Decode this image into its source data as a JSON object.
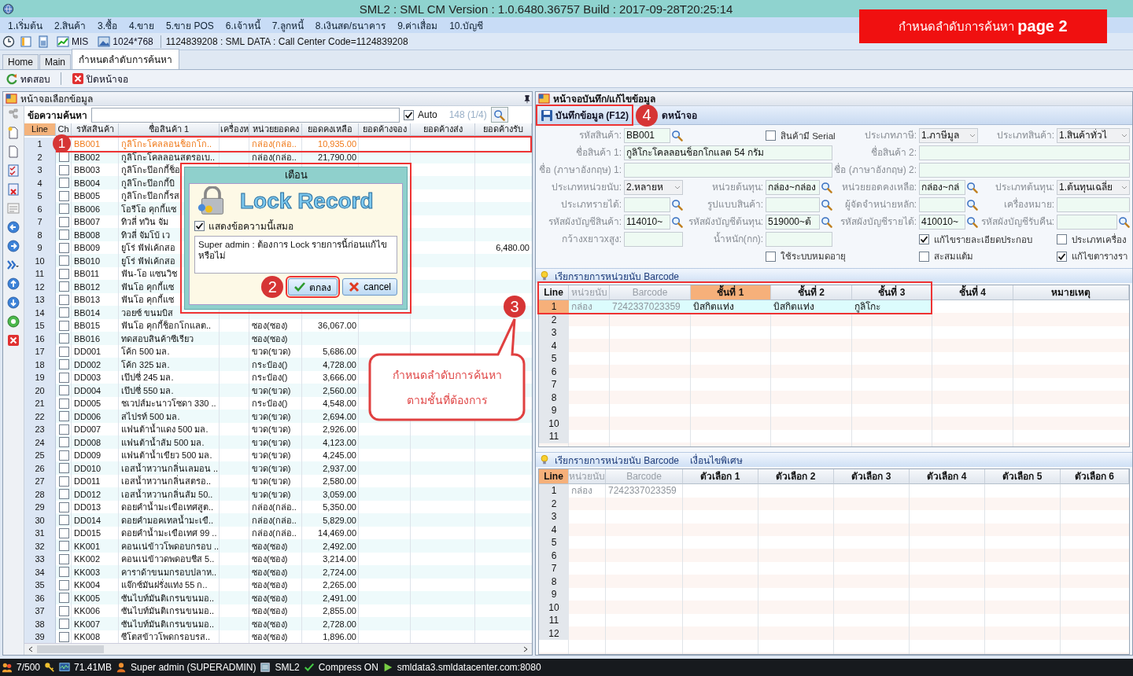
{
  "window": {
    "title": "SML2 : SML CM Version : 1.0.6480.36757  Build : 2017-09-28T20:25:14"
  },
  "banner": "กำหนดลำดับการค้นหา **page 2**",
  "menu": [
    "1.เริ่มต้น",
    "2.สินค้า",
    "3.ซื้อ",
    "4.ขาย",
    "5.ขาย POS",
    "6.เจ้าหนี้",
    "7.ลูกหนี้",
    "8.เงินสด/ธนาคาร",
    "9.ค่าเสื่อม",
    "10.บัญชี"
  ],
  "toolbar": {
    "mis": "MIS",
    "resolution": "1024*768",
    "info": "1124839208 : SML DATA : Call Center Code=1124839208"
  },
  "tabs": [
    {
      "label": "Home",
      "selected": false
    },
    {
      "label": "Main",
      "selected": false
    },
    {
      "label": "กำหนดลำดับการค้นหา",
      "selected": true
    }
  ],
  "actions": [
    "ทดสอบ",
    "ปิดหน้าจอ"
  ],
  "left_panel": {
    "title": "หน้าจอเลือกข้อมูล",
    "search_label": "ข้อความค้นหา",
    "auto": {
      "label": "Auto",
      "checked": true
    },
    "count": "148 (1/4)",
    "columns": [
      "Line",
      "Ch",
      "รหัสสินค้า",
      "ชื่อสินค้า 1",
      "เครื่องห",
      "หน่วยยอดคง",
      "ยอดคงเหลือ",
      "ยอดค้างจอง",
      "ยอดค้างส่ง",
      "ยอดค้างรับ"
    ],
    "rows": [
      {
        "line": "1",
        "code": "BB001",
        "name": "กูลิโกะโคลลอนช็อกโก..",
        "unit": "กล่อง(กล่อ..",
        "balance": "10,935.00",
        "selected": true
      },
      {
        "line": "2",
        "code": "BB002",
        "name": "กูลิโกะโคลลอนสตรอเบ..",
        "unit": "กล่อง(กล่อ..",
        "balance": "21,790.00",
        "checked": false,
        "selected": false
      },
      {
        "line": "3",
        "code": "BB003",
        "name": "กูลิโกะป๊อกกี้ช็อ",
        "checked": false,
        "selected": false
      },
      {
        "line": "4",
        "code": "BB004",
        "name": "กูลิโกะป๊อกกี้บิ",
        "checked": false,
        "selected": false
      },
      {
        "line": "5",
        "code": "BB005",
        "name": "กูลิโกะป๊อกกี้รส",
        "checked": false,
        "selected": false
      },
      {
        "line": "6",
        "code": "BB006",
        "name": "โอรีโอ คุกกี้แซ",
        "checked": false,
        "selected": false
      },
      {
        "line": "7",
        "code": "BB007",
        "name": "ทิวลี่ ทวิน จัม",
        "checked": false,
        "selected": false
      },
      {
        "line": "8",
        "code": "BB008",
        "name": "ทิวลี่ จัมโบ้ เว",
        "checked": false,
        "selected": false
      },
      {
        "line": "9",
        "code": "BB009",
        "name": "ยูโร่ ฟัฟเค้กสอ",
        "incoming": "6,480.00",
        "checked": false,
        "selected": false
      },
      {
        "line": "10",
        "code": "BB010",
        "name": "ยูโร่ ฟัฟเค้กสอ",
        "checked": false,
        "selected": false
      },
      {
        "line": "11",
        "code": "BB011",
        "name": "ฟัน-โอ แซนวิช",
        "checked": false,
        "selected": false
      },
      {
        "line": "12",
        "code": "BB012",
        "name": "ฟันโอ คุกกี้แซ",
        "checked": false,
        "selected": false
      },
      {
        "line": "13",
        "code": "BB013",
        "name": "ฟันโอ คุกกี้แซ",
        "checked": false,
        "selected": false
      },
      {
        "line": "14",
        "code": "BB014",
        "name": "วอยซ์ ขนมบิส",
        "checked": false,
        "selected": false
      },
      {
        "line": "15",
        "code": "BB015",
        "name": "ฟันโอ คุกกี้ช็อกโกแลต..",
        "unit": "ซอง(ซอง)",
        "balance": "36,067.00",
        "checked": false,
        "selected": false
      },
      {
        "line": "16",
        "code": "BB016",
        "name": "ทดสอบสินค้าซีเรียว",
        "unit": "ซอง(ซอง)",
        "checked": false,
        "selected": false
      },
      {
        "line": "17",
        "code": "DD001",
        "name": "โค้ก 500 มล.",
        "unit": "ขวด(ขวด)",
        "balance": "5,686.00",
        "checked": false,
        "selected": false
      },
      {
        "line": "18",
        "code": "DD002",
        "name": "โค้ก 325 มล.",
        "unit": "กระป๋อง()",
        "balance": "4,728.00",
        "checked": false,
        "selected": false
      },
      {
        "line": "19",
        "code": "DD003",
        "name": "เป๊ปซี่ 245 มล.",
        "unit": "กระป๋อง()",
        "balance": "3,666.00",
        "checked": false,
        "selected": false
      },
      {
        "line": "20",
        "code": "DD004",
        "name": "เป๊ปซี่ 550 มล.",
        "unit": "ขวด(ขวด)",
        "balance": "2,560.00",
        "checked": false,
        "selected": false
      },
      {
        "line": "21",
        "code": "DD005",
        "name": "ชเวปส์มะนาวโซดา 330 ..",
        "unit": "กระป๋อง()",
        "balance": "4,548.00",
        "checked": false,
        "selected": false
      },
      {
        "line": "22",
        "code": "DD006",
        "name": "สไปรท์ 500 มล.",
        "unit": "ขวด(ขวด)",
        "balance": "2,694.00",
        "checked": false,
        "selected": false
      },
      {
        "line": "23",
        "code": "DD007",
        "name": "แฟนต้าน้ำแดง 500 มล.",
        "unit": "ขวด(ขวด)",
        "balance": "2,926.00",
        "checked": false,
        "selected": false
      },
      {
        "line": "24",
        "code": "DD008",
        "name": "แฟนต้าน้ำส้ม 500 มล.",
        "unit": "ขวด(ขวด)",
        "balance": "4,123.00",
        "checked": false,
        "selected": false
      },
      {
        "line": "25",
        "code": "DD009",
        "name": "แฟนต้าน้ำเขียว 500 มล.",
        "unit": "ขวด(ขวด)",
        "balance": "4,245.00",
        "checked": false,
        "selected": false
      },
      {
        "line": "26",
        "code": "DD010",
        "name": "เอสน้ำหวานกลิ่นเลมอน ..",
        "unit": "ขวด(ขวด)",
        "balance": "2,937.00",
        "checked": false,
        "selected": false
      },
      {
        "line": "27",
        "code": "DD011",
        "name": "เอสน้ำหวานกลิ่นสตรอ..",
        "unit": "ขวด(ขวด)",
        "balance": "2,580.00",
        "checked": false,
        "selected": false
      },
      {
        "line": "28",
        "code": "DD012",
        "name": "เอสน้ำหวานกลิ่นส้ม 50..",
        "unit": "ขวด(ขวด)",
        "balance": "3,059.00",
        "checked": false,
        "selected": false
      },
      {
        "line": "29",
        "code": "DD013",
        "name": "ดอยคำน้ำมะเขือเทศสูต..",
        "unit": "กล่อง(กล่อ..",
        "balance": "5,350.00",
        "checked": false,
        "selected": false
      },
      {
        "line": "30",
        "code": "DD014",
        "name": "ดอยคำมอคเทลน้ำมะเขื..",
        "unit": "กล่อง(กล่อ..",
        "balance": "5,829.00",
        "checked": false,
        "selected": false
      },
      {
        "line": "31",
        "code": "DD015",
        "name": "ดอยคำน้ำมะเขือเทศ 99 ..",
        "unit": "กล่อง(กล่อ..",
        "balance": "14,469.00",
        "checked": false,
        "selected": false
      },
      {
        "line": "32",
        "code": "KK001",
        "name": "คอนเน่ข้าวโพดอบกรอบ ..",
        "unit": "ซอง(ซอง)",
        "balance": "2,492.00",
        "checked": false,
        "selected": false
      },
      {
        "line": "33",
        "code": "KK002",
        "name": "คอนเน่ข้าวดพดอบชีส 5..",
        "unit": "ซอง(ซอง)",
        "balance": "3,214.00",
        "checked": false,
        "selected": false
      },
      {
        "line": "34",
        "code": "KK003",
        "name": "คาราด้าขนมกรอบปลาห..",
        "unit": "ซอง(ซอง)",
        "balance": "2,724.00",
        "checked": false,
        "selected": false
      },
      {
        "line": "35",
        "code": "KK004",
        "name": "แจ๊กซ์มันฝรั่งแท่ง 55 ก..",
        "unit": "ซอง(ซอง)",
        "balance": "2,265.00",
        "checked": false,
        "selected": false
      },
      {
        "line": "36",
        "code": "KK005",
        "name": "ซันไบท์มันติเกรนขนมอ..",
        "unit": "ซอง(ซอง)",
        "balance": "2,491.00",
        "checked": false,
        "selected": false
      },
      {
        "line": "37",
        "code": "KK006",
        "name": "ซันไบท์มันติเกรนขนมอ..",
        "unit": "ซอง(ซอง)",
        "balance": "2,855.00",
        "checked": false,
        "selected": false
      },
      {
        "line": "38",
        "code": "KK007",
        "name": "ซันไบท์มันติเกรนขนมอ..",
        "unit": "ซอง(ซอง)",
        "balance": "2,728.00",
        "checked": false,
        "selected": false
      },
      {
        "line": "39",
        "code": "KK008",
        "name": "ซีโตสข้าวโพดกรอบรส..",
        "unit": "ซอง(ซอง)",
        "balance": "1,896.00",
        "checked": false,
        "selected": false
      }
    ]
  },
  "dialog": {
    "title": "เตือน",
    "heading": "Lock Record",
    "always_show": {
      "label": "แสดงข้อความนี้เสมอ",
      "checked": true
    },
    "message": "Super admin : ต้องการ Lock รายการนี้ก่อนแก้ไข หรือไม่",
    "buttons": [
      "ตกลง",
      "cancel"
    ]
  },
  "right_panel": {
    "title": "หน้าจอบันทึก/แก้ไขข้อมูล",
    "actions": [
      "บันทึกข้อมูล (F12)",
      "ดหน้าจอ"
    ],
    "form": [
      [
        {
          "kind": "lookup",
          "label": "รหัสสินค้า:",
          "value": "BB001"
        },
        {
          "kind": "checkbox",
          "label": "สินค้ามี Serial",
          "checked": false
        },
        {
          "kind": "select",
          "label": "ประเภทภาษี:",
          "value": "1.ภาษีมูล"
        },
        {
          "kind": "select",
          "label": "ประเภทสินค้า:",
          "value": "1.สินค้าทั่วไ"
        }
      ],
      [
        {
          "kind": "wide",
          "label": "ชื่อสินค้า 1:",
          "value": "กูลิโกะโคลลอนช็อกโกแลต 54 กรัม"
        },
        {
          "kind": "wide",
          "label": "ชื่อสินค้า 2:"
        }
      ],
      [
        {
          "kind": "wide",
          "label": "ชื่อ (ภาษาอังกฤษ) 1:"
        },
        {
          "kind": "wide",
          "label": "ชื่อ (ภาษาอังกฤษ) 2:"
        }
      ],
      [
        {
          "kind": "select",
          "label": "ประเภทหน่วยนับ:",
          "value": "2.หลายห"
        },
        {
          "kind": "lookup",
          "label": "หน่วยต้นทุน:",
          "value": "กล่อง~กล่อง"
        },
        {
          "kind": "lookup",
          "label": "หน่วยยอดคงเหลือ:",
          "value": "กล่อง~กล่"
        },
        {
          "kind": "select",
          "label": "ประเภทต้นทุน:",
          "value": "1.ต้นทุนเฉลี่ย"
        }
      ],
      [
        {
          "kind": "lookup",
          "label": "ประเภทรายได้:"
        },
        {
          "kind": "lookup",
          "label": "รูปแบบสินค้า:"
        },
        {
          "kind": "lookup",
          "label": "ผู้จัดจำหน่ายหลัก:"
        },
        {
          "kind": "field",
          "label": "เครื่องหมาย:"
        }
      ],
      [
        {
          "kind": "lookup",
          "label": "รหัสผังบัญชีสินค้า:",
          "value": "114010~"
        },
        {
          "kind": "lookup",
          "label": "รหัสผังบัญชีต้นทุน:",
          "value": "519000~ต้"
        },
        {
          "kind": "lookup",
          "label": "รหัสผังบัญชีรายได้:",
          "value": "410010~"
        },
        {
          "kind": "lookup",
          "label": "รหัสผังบัญชีรับคืน:"
        }
      ],
      [
        {
          "kind": "field",
          "label": "กว้างxยาวxสูง:"
        },
        {
          "kind": "field",
          "label": "น้ำหนัก(กก):"
        },
        {
          "kind": "checkbox",
          "label": "แก้ไขรายละเอียดประกอบ",
          "checked": true
        },
        {
          "kind": "checkbox",
          "label": "ประเภทเครื่อง",
          "checked": false
        }
      ],
      [
        {
          "kind": "checkbox",
          "label": "ใช้ระบบหมดอายุ",
          "checked": false
        },
        {
          "kind": "checkbox",
          "label": "สะสมแต้ม",
          "checked": false
        },
        {
          "kind": "checkbox",
          "label": "แก้ไขตารางรา",
          "checked": true
        }
      ]
    ],
    "unit_grid": {
      "title": "เรียกรายการหน่วยนับ Barcode",
      "columns": [
        {
          "label": "Line",
          "selected": false,
          "disabled": false
        },
        {
          "label": "หน่วยนับ",
          "selected": false,
          "disabled": true
        },
        {
          "label": "Barcode",
          "selected": false,
          "disabled": true
        },
        {
          "label": "ชั้นที่ 1",
          "selected": true,
          "disabled": false
        },
        {
          "label": "ชั้นที่ 2",
          "selected": false,
          "disabled": false
        },
        {
          "label": "ชั้นที่ 3",
          "selected": false,
          "disabled": false
        },
        {
          "label": "ชั้นที่ 4",
          "selected": false,
          "disabled": false
        },
        {
          "label": "หมายเหตุ",
          "selected": false,
          "disabled": false
        }
      ],
      "rows": [
        {
          "line": "1",
          "cells": [
            "กล่อง",
            "7242337023359",
            "บิสกิตแท่ง",
            "บิสกิตแท่ง",
            "กูลิโกะ"
          ],
          "selected": true
        },
        {
          "line": "2",
          "selected": false
        },
        {
          "line": "3",
          "selected": false
        },
        {
          "line": "4",
          "selected": false
        },
        {
          "line": "5",
          "selected": false
        },
        {
          "line": "6",
          "selected": false
        },
        {
          "line": "7",
          "selected": false
        },
        {
          "line": "8",
          "selected": false
        },
        {
          "line": "9",
          "selected": false
        },
        {
          "line": "10",
          "selected": false
        },
        {
          "line": "11",
          "selected": false
        }
      ]
    },
    "option_grid": {
      "title": "เรียกรายการหน่วยนับ Barcode",
      "subtitle": "เงื่อนไขพิเศษ",
      "columns": [
        {
          "label": "Line",
          "selected": true,
          "disabled": false
        },
        {
          "label": "หน่วยนับ",
          "selected": false,
          "disabled": true
        },
        {
          "label": "Barcode",
          "selected": false,
          "disabled": true
        },
        {
          "label": "ตัวเลือก 1",
          "selected": false,
          "disabled": false
        },
        {
          "label": "ตัวเลือก 2",
          "selected": false,
          "disabled": false
        },
        {
          "label": "ตัวเลือก 3",
          "selected": false,
          "disabled": false
        },
        {
          "label": "ตัวเลือก 4",
          "selected": false,
          "disabled": false
        },
        {
          "label": "ตัวเลือก 5",
          "selected": false,
          "disabled": false
        },
        {
          "label": "ตัวเลือก 6",
          "selected": false,
          "disabled": false
        }
      ],
      "rows": [
        {
          "line": "1",
          "cells": [
            "กล่อง",
            "7242337023359"
          ],
          "selected": false
        },
        {
          "line": "2",
          "selected": false
        },
        {
          "line": "3",
          "selected": false
        },
        {
          "line": "4",
          "selected": false
        },
        {
          "line": "5",
          "selected": false
        },
        {
          "line": "6",
          "selected": false
        },
        {
          "line": "7",
          "selected": false
        },
        {
          "line": "8",
          "selected": false
        },
        {
          "line": "9",
          "selected": false
        },
        {
          "line": "10",
          "selected": false
        },
        {
          "line": "11",
          "selected": false
        },
        {
          "line": "12",
          "selected": false
        }
      ]
    }
  },
  "annotations": [
    {
      "number": "1"
    },
    {
      "number": "2"
    },
    {
      "number": "3"
    },
    {
      "number": "4"
    }
  ],
  "callout": [
    "กำหนดลำดับการค้นหา",
    "ตามชั้นที่ต้องการ"
  ],
  "status_bar": [
    "7/500",
    "71.41MB",
    "Super admin (SUPERADMIN)",
    "SML2",
    "Compress ON",
    "smldata3.smldatacenter.com:8080"
  ]
}
